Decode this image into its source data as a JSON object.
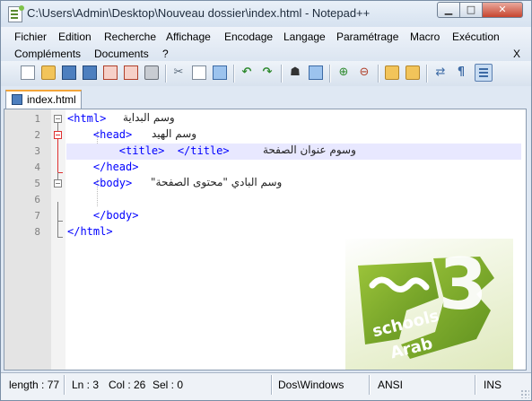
{
  "window": {
    "title": "C:\\Users\\Admin\\Desktop\\Nouveau dossier\\index.html - Notepad++",
    "min_glyph": "▁",
    "max_glyph": "□",
    "close_glyph": "✕"
  },
  "menu": {
    "row1": [
      "Fichier",
      "Edition",
      "Recherche",
      "Affichage",
      "Encodage",
      "Langage",
      "Paramétrage",
      "Macro",
      "Exécution"
    ],
    "row2": [
      "Compléments",
      "Documents",
      "?"
    ],
    "close_label": "X"
  },
  "toolbar": {
    "icons": [
      "new-file",
      "open-folder",
      "save",
      "save-all",
      "close",
      "close-all",
      "print",
      "cut",
      "copy",
      "paste",
      "undo",
      "redo",
      "find",
      "replace",
      "zoom-in",
      "zoom-out",
      "sync-vertical",
      "sync-horizontal",
      "word-wrap",
      "show-all-characters",
      "indent-guide"
    ],
    "cut_glyph": "✂",
    "undo_glyph": "↶",
    "redo_glyph": "↷",
    "find_glyph": "☗",
    "zoomin_glyph": "⊕",
    "zoomout_glyph": "⊖",
    "pilcrow_glyph": "¶",
    "wrap_glyph": "⇄"
  },
  "tab": {
    "label": "index.html"
  },
  "editor": {
    "lines": [
      {
        "number": "1",
        "code": "<html>",
        "comment": "وسم البداية"
      },
      {
        "number": "2",
        "code": "    <head>",
        "comment": "وسم الهيد"
      },
      {
        "number": "3",
        "code": "        <title>  </title>",
        "comment": "وسوم عنوان الصفحة"
      },
      {
        "number": "4",
        "code": "    </head>",
        "comment": ""
      },
      {
        "number": "5",
        "code": "    <body>",
        "comment": "وسم البادي \"محتوى الصفحة\""
      },
      {
        "number": "6",
        "code": "",
        "comment": ""
      },
      {
        "number": "7",
        "code": "    </body>",
        "comment": ""
      },
      {
        "number": "8",
        "code": "</html>",
        "comment": ""
      }
    ],
    "current_line": 3
  },
  "logo": {
    "numeral": "3",
    "text_line1": "schools",
    "text_line2": "Arab",
    "colors": {
      "green_dark": "#5d8f1e",
      "green_light": "#9cc43a",
      "text": "#ffffff"
    }
  },
  "status": {
    "length": "length : 77",
    "ln": "Ln : 3",
    "col": "Col : 26",
    "sel": "Sel : 0",
    "eol": "Dos\\Windows",
    "encoding": "ANSI",
    "mode": "INS"
  },
  "colors": {
    "tag": "#0000ff",
    "current_line": "#e8e8ff",
    "fold_active": "#e03030"
  }
}
